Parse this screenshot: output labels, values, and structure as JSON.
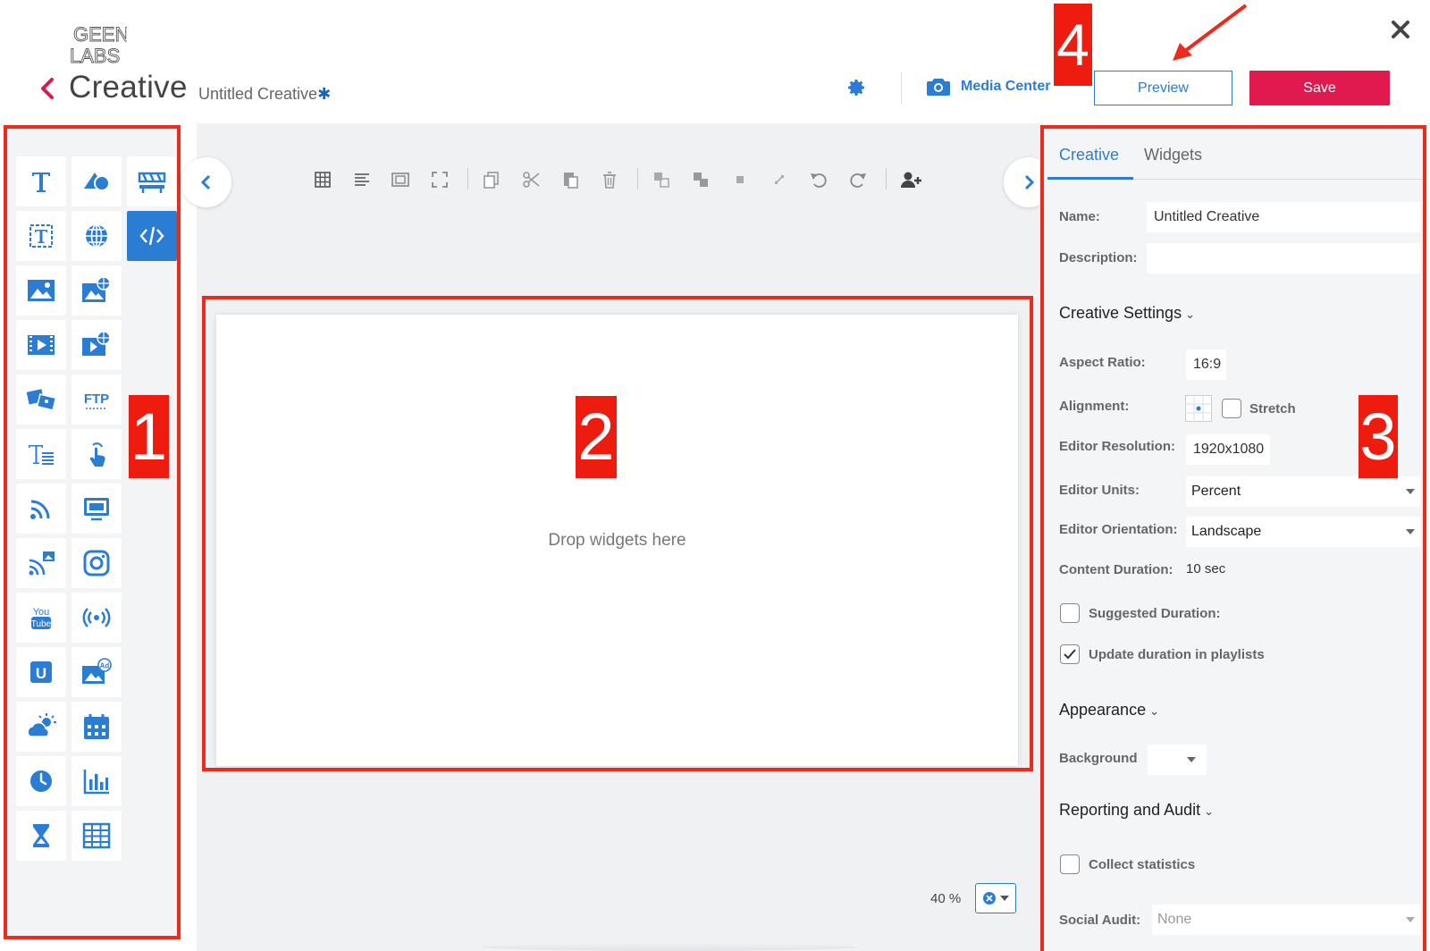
{
  "header": {
    "logo_top": "GEEN",
    "logo_bottom": "LABS",
    "app_title": "Creative",
    "document_title": "Untitled Creative",
    "unsaved_marker": "✱",
    "media_center_label": "Media Center",
    "preview_label": "Preview",
    "save_label": "Save"
  },
  "annotations": {
    "one": "1",
    "two": "2",
    "three": "3",
    "four": "4"
  },
  "widget_panel": {
    "items": [
      "text-widget-icon",
      "shapes-icon",
      "ticker-icon",
      "text-box-icon",
      "web-page-icon",
      "html-code-icon",
      "image-icon",
      "web-image-icon",
      "video-icon",
      "web-video-icon",
      "slideshow-icon",
      "ftp-icon",
      "rich-text-icon",
      "touch-icon",
      "rss-icon",
      "screen-capture-icon",
      "rss-media-icon",
      "instagram-icon",
      "youtube-icon",
      "live-stream-icon",
      "u-icon",
      "ad-image-icon",
      "weather-icon",
      "calendar-icon",
      "clock-icon",
      "chart-icon",
      "countdown-icon",
      "table-icon"
    ],
    "ftp_label": "FTP",
    "youtube_label_top": "You",
    "youtube_label_bottom": "Tube",
    "u_label": "U",
    "ad_label": "Ad"
  },
  "canvas": {
    "drop_text": "Drop widgets here",
    "zoom_label": "40 %"
  },
  "properties": {
    "tabs": [
      "Creative",
      "Widgets"
    ],
    "name_label": "Name:",
    "name_value": "Untitled Creative",
    "description_label": "Description:",
    "description_value": "",
    "creative_settings_title": "Creative Settings",
    "aspect_ratio_label": "Aspect Ratio:",
    "aspect_ratio_value": "16:9",
    "alignment_label": "Alignment:",
    "stretch_label": "Stretch",
    "editor_resolution_label": "Editor Resolution:",
    "editor_resolution_value": "1920x1080",
    "editor_units_label": "Editor Units:",
    "editor_units_value": "Percent",
    "editor_orientation_label": "Editor Orientation:",
    "editor_orientation_value": "Landscape",
    "content_duration_label": "Content Duration:",
    "content_duration_value": "10 sec",
    "suggested_duration_label": "Suggested Duration:",
    "update_duration_label": "Update duration in playlists",
    "appearance_title": "Appearance",
    "background_label": "Background",
    "reporting_title": "Reporting and Audit",
    "collect_statistics_label": "Collect statistics",
    "social_audit_label": "Social Audit:",
    "social_audit_value": "None"
  },
  "colors": {
    "accent": "#2b7cd3",
    "save": "#e01a4f",
    "annotation": "#ee2a1d"
  }
}
